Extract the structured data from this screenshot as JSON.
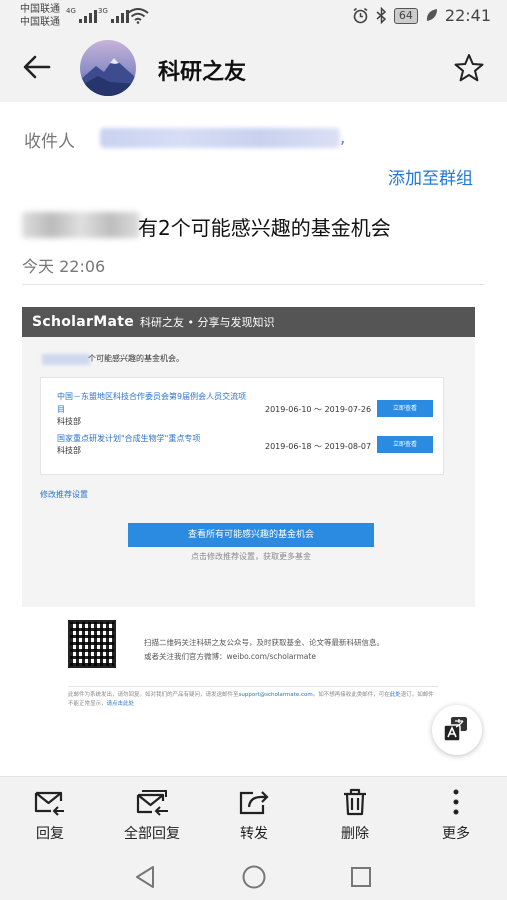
{
  "statusbar": {
    "carrier_1": "中国联通",
    "carrier_2": "中国联通",
    "net_1": "4G",
    "net_2": "3G",
    "battery": "64",
    "time": "22:41"
  },
  "header": {
    "title": "科研之友"
  },
  "recipient": {
    "label": "收件人",
    "trailing": ",",
    "add_group": "添加至群组"
  },
  "message": {
    "subject_visible": "有2个可能感兴趣的基金机会",
    "date": "今天 22:06"
  },
  "email": {
    "brand": "ScholarMate",
    "brand_tagline": "科研之友 • 分享与发现知识",
    "intro": "个可能感兴趣的基金机会。",
    "items": [
      {
        "title": "中国－东盟地区科技合作委员会第9届例会人员交流项目",
        "org": "科技部",
        "dates": "2019-06-10 ～ 2019-07-26",
        "button": "立即查看"
      },
      {
        "title": "国家重点研发计划\"合成生物学\"重点专项",
        "org": "科技部",
        "dates": "2019-06-18 ～ 2019-08-07",
        "button": "立即查看"
      }
    ],
    "modify_link": "修改推荐设置",
    "cta": "查看所有可能感兴趣的基金机会",
    "cta_sub": "点击修改推荐设置，获取更多基金",
    "footer_line1": "扫描二维码关注科研之友公众号，及时获取基金、论文等最新科研信息。",
    "footer_line2": "或者关注我们官方微博：weibo.com/scholarmate",
    "legal_1": "此邮件为系统发出，请勿回复。如对我们的产品有疑问，请发送邮件至",
    "legal_email": "support@scholarmate.com",
    "legal_2": "。如不想再接收此类邮件，可在",
    "legal_link1": "此处",
    "legal_3": "退订。如邮件不能正常显示，",
    "legal_link2": "请点击此处"
  },
  "toolbar": {
    "reply": "回复",
    "reply_all": "全部回复",
    "forward": "转发",
    "delete": "删除",
    "more": "更多"
  },
  "icons": {
    "back": "arrow-left-icon",
    "star": "star-icon",
    "translate": "translate-icon",
    "reply": "reply-icon",
    "reply_all": "reply-all-icon",
    "forward": "forward-icon",
    "delete": "trash-icon",
    "more": "more-vertical-icon",
    "nav_back": "triangle-back-icon",
    "nav_home": "circle-home-icon",
    "nav_recent": "square-recent-icon"
  },
  "colors": {
    "accent": "#1f7ad8",
    "button_blue": "#2b8be0",
    "brand_bar": "#555555"
  }
}
